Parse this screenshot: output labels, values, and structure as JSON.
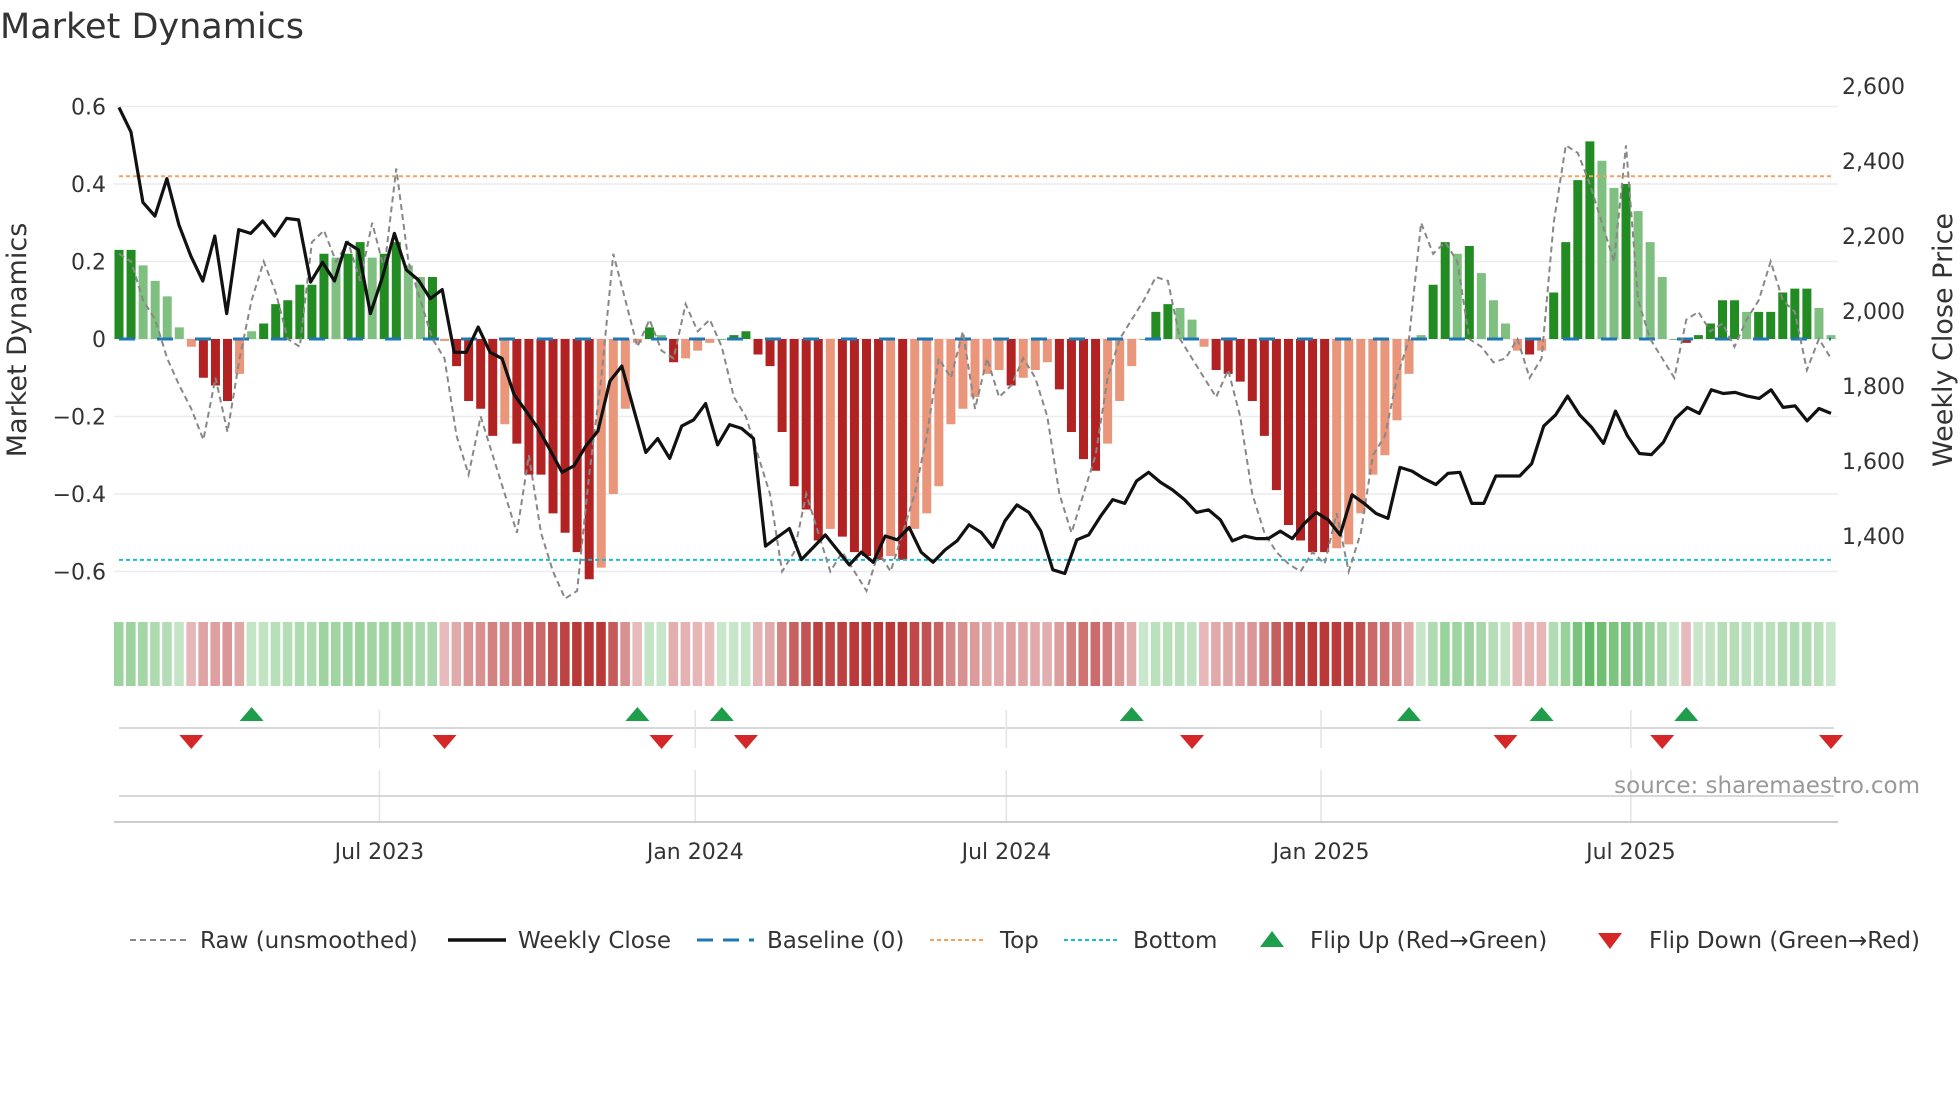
{
  "chart_data": {
    "type": "bar",
    "title": "Market Dynamics",
    "ylabel": "Market Dynamics",
    "y2label": "Weekly Close Price",
    "ylim": [
      -0.68,
      0.63
    ],
    "y2lim": [
      1240,
      2620
    ],
    "yticks": [
      0.6,
      0.4,
      0.2,
      0,
      -0.2,
      -0.4,
      -0.6
    ],
    "ytick_labels": [
      "0.6",
      "0.4",
      "0.2",
      "0",
      "−0.2",
      "−0.4",
      "−0.6"
    ],
    "y2ticks": [
      2600,
      2400,
      2200,
      2000,
      1800,
      1600,
      1400
    ],
    "y2tick_labels": [
      "2,600",
      "2,400",
      "2,200",
      "2,000",
      "1,800",
      "1,600",
      "1,400"
    ],
    "x_unit": "week index",
    "xticks": [
      21.6,
      47.8,
      73.6,
      99.7,
      125.4
    ],
    "xtick_labels": [
      "Jul 2023",
      "Jan 2024",
      "Jul 2024",
      "Jan 2025",
      "Jul 2025"
    ],
    "top_level": 0.42,
    "bottom_level": -0.57,
    "baseline": 0,
    "values": [
      0.23,
      0.23,
      0.19,
      0.15,
      0.11,
      0.03,
      -0.02,
      -0.1,
      -0.12,
      -0.16,
      -0.09,
      0.02,
      0.04,
      0.09,
      0.1,
      0.14,
      0.14,
      0.22,
      0.21,
      0.22,
      0.25,
      0.21,
      0.22,
      0.25,
      0.19,
      0.16,
      0.16,
      -0.005,
      -0.07,
      -0.16,
      -0.18,
      -0.25,
      -0.22,
      -0.27,
      -0.35,
      -0.35,
      -0.45,
      -0.5,
      -0.55,
      -0.62,
      -0.59,
      -0.4,
      -0.18,
      -0.01,
      0.03,
      0.01,
      -0.06,
      -0.05,
      -0.03,
      -0.01,
      0.0,
      0.01,
      0.02,
      -0.04,
      -0.07,
      -0.24,
      -0.38,
      -0.44,
      -0.52,
      -0.49,
      -0.51,
      -0.55,
      -0.56,
      -0.57,
      -0.56,
      -0.57,
      -0.49,
      -0.45,
      -0.38,
      -0.22,
      -0.18,
      -0.15,
      -0.09,
      -0.08,
      -0.12,
      -0.1,
      -0.08,
      -0.06,
      -0.13,
      -0.24,
      -0.31,
      -0.34,
      -0.27,
      -0.16,
      -0.07,
      0.0,
      0.07,
      0.09,
      0.08,
      0.05,
      -0.02,
      -0.08,
      -0.09,
      -0.11,
      -0.16,
      -0.25,
      -0.39,
      -0.48,
      -0.52,
      -0.55,
      -0.55,
      -0.54,
      -0.53,
      -0.45,
      -0.35,
      -0.3,
      -0.21,
      -0.09,
      0.01,
      0.14,
      0.25,
      0.22,
      0.24,
      0.17,
      0.1,
      0.04,
      -0.03,
      -0.04,
      -0.03,
      0.12,
      0.25,
      0.41,
      0.51,
      0.46,
      0.39,
      0.4,
      0.33,
      0.25,
      0.16,
      0.0,
      -0.01,
      0.01,
      0.04,
      0.1,
      0.1,
      0.07,
      0.07,
      0.07,
      0.12,
      0.13,
      0.13,
      0.08,
      0.01
    ],
    "raw": [
      0.22,
      0.2,
      0.1,
      0.05,
      -0.05,
      -0.12,
      -0.18,
      -0.26,
      -0.1,
      -0.24,
      -0.05,
      0.1,
      0.2,
      0.12,
      0.0,
      -0.02,
      0.25,
      0.28,
      0.2,
      0.25,
      0.15,
      0.3,
      0.18,
      0.44,
      0.2,
      0.1,
      0.0,
      -0.05,
      -0.25,
      -0.35,
      -0.2,
      -0.3,
      -0.4,
      -0.5,
      -0.3,
      -0.5,
      -0.6,
      -0.67,
      -0.65,
      -0.35,
      -0.1,
      0.22,
      0.1,
      -0.02,
      0.05,
      -0.03,
      -0.05,
      0.09,
      0.02,
      0.05,
      -0.02,
      -0.15,
      -0.2,
      -0.3,
      -0.4,
      -0.6,
      -0.55,
      -0.4,
      -0.5,
      -0.6,
      -0.55,
      -0.6,
      -0.65,
      -0.55,
      -0.6,
      -0.5,
      -0.4,
      -0.25,
      -0.05,
      -0.1,
      0.02,
      -0.18,
      -0.05,
      -0.15,
      -0.12,
      -0.05,
      -0.1,
      -0.2,
      -0.4,
      -0.5,
      -0.4,
      -0.3,
      -0.1,
      0.0,
      0.05,
      0.1,
      0.16,
      0.15,
      0.0,
      -0.05,
      -0.1,
      -0.15,
      -0.08,
      -0.2,
      -0.4,
      -0.5,
      -0.55,
      -0.58,
      -0.6,
      -0.55,
      -0.58,
      -0.45,
      -0.6,
      -0.5,
      -0.3,
      -0.25,
      -0.1,
      0.0,
      0.3,
      0.22,
      0.25,
      0.2,
      0.0,
      -0.02,
      -0.06,
      -0.05,
      0.0,
      -0.1,
      -0.05,
      0.3,
      0.5,
      0.48,
      0.4,
      0.3,
      0.2,
      0.5,
      0.1,
      0.0,
      -0.05,
      -0.1,
      0.05,
      0.07,
      0.02,
      0.04,
      -0.02,
      0.05,
      0.1,
      0.2,
      0.1,
      0.07,
      -0.08,
      0.0,
      -0.05
    ],
    "close": [
      2543,
      2477,
      2290,
      2253,
      2353,
      2230,
      2147,
      2080,
      2200,
      1993,
      2217,
      2207,
      2240,
      2200,
      2247,
      2243,
      2077,
      2130,
      2080,
      2183,
      2163,
      1993,
      2090,
      2207,
      2110,
      2083,
      2033,
      2057,
      1890,
      1890,
      1957,
      1890,
      1873,
      1777,
      1733,
      1687,
      1630,
      1570,
      1587,
      1640,
      1680,
      1813,
      1853,
      1737,
      1623,
      1660,
      1607,
      1693,
      1710,
      1753,
      1643,
      1697,
      1687,
      1660,
      1373,
      1397,
      1420,
      1337,
      1370,
      1403,
      1363,
      1323,
      1357,
      1330,
      1400,
      1390,
      1423,
      1357,
      1330,
      1363,
      1387,
      1430,
      1410,
      1370,
      1440,
      1483,
      1463,
      1413,
      1310,
      1300,
      1390,
      1403,
      1453,
      1497,
      1487,
      1547,
      1570,
      1543,
      1523,
      1497,
      1463,
      1470,
      1443,
      1387,
      1400,
      1393,
      1393,
      1413,
      1393,
      1433,
      1463,
      1443,
      1403,
      1510,
      1487,
      1460,
      1447,
      1583,
      1573,
      1553,
      1537,
      1567,
      1570,
      1487,
      1487,
      1560,
      1560,
      1560,
      1593,
      1693,
      1723,
      1773,
      1723,
      1690,
      1647,
      1733,
      1667,
      1620,
      1617,
      1650,
      1713,
      1743,
      1727,
      1790,
      1780,
      1783,
      1773,
      1767,
      1790,
      1743,
      1747,
      1707,
      1740,
      1727
    ],
    "flip_up": [
      11,
      43,
      50,
      84,
      107,
      118,
      130
    ],
    "flip_down": [
      6,
      27,
      45,
      52,
      89,
      115,
      128,
      142
    ],
    "legend_position": "bottom",
    "legend": {
      "raw": "Raw (unsmoothed)",
      "close": "Weekly Close",
      "baseline": "Baseline (0)",
      "top": "Top",
      "bottom": "Bottom",
      "flip_up": "Flip Up (Red→Green)",
      "flip_down": "Flip Down (Green→Red)"
    },
    "source": "source: sharemaestro.com",
    "colors": {
      "green_dark": "#228b22",
      "green_light": "#7fbf7f",
      "red_dark": "#b22222",
      "red_light": "#e9967a",
      "raw": "#888888",
      "close": "#111111",
      "baseline": "#1f77b4",
      "top": "#f4a460",
      "bottom": "#17becf",
      "flip_up": "#1e9e4a",
      "flip_down": "#d62728"
    }
  }
}
